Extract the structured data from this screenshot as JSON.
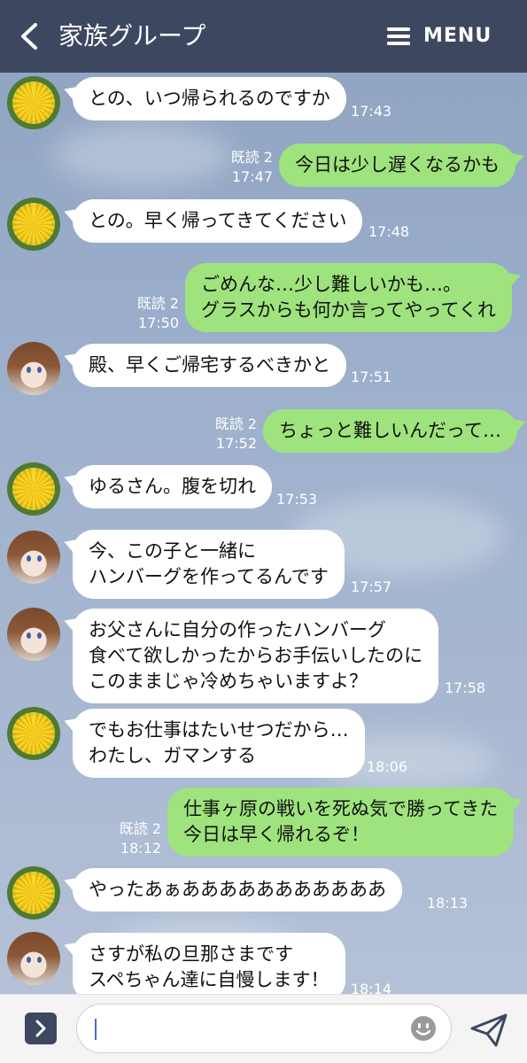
{
  "header": {
    "title": "家族グループ",
    "menu_label": "MENU"
  },
  "messages": [
    {
      "side": "left",
      "avatar": "dandelion",
      "text": "との、いつ帰られるのですか",
      "time": "17:43"
    },
    {
      "side": "right",
      "read": "既読 2",
      "text": "今日は少し遅くなるかも",
      "time": "17:47"
    },
    {
      "side": "left",
      "avatar": "dandelion",
      "text": "との。早く帰ってきてください",
      "time": "17:48"
    },
    {
      "side": "right",
      "read": "既読 2",
      "text": "ごめんな…少し難しいかも…。\nグラスからも何か言ってやってくれ",
      "time": "17:50"
    },
    {
      "side": "left",
      "avatar": "girl",
      "text": "殿、早くご帰宅するべきかと",
      "time": "17:51"
    },
    {
      "side": "right",
      "read": "既読 2",
      "text": "ちょっと難しいんだって…",
      "time": "17:52"
    },
    {
      "side": "left",
      "avatar": "dandelion",
      "text": "ゆるさん。腹を切れ",
      "time": "17:53"
    },
    {
      "side": "left",
      "avatar": "girl",
      "text": "今、この子と一緒に\nハンバーグを作ってるんです",
      "time": "17:57"
    },
    {
      "side": "left",
      "avatar": "girl",
      "text": "お父さんに自分の作ったハンバーグ\n食べて欲しかったからお手伝いしたのに\nこのままじゃ冷めちゃいますよ？",
      "time": "17:58"
    },
    {
      "side": "left",
      "avatar": "dandelion",
      "text": "でもお仕事はたいせつだから…\nわたし、ガマンする",
      "time": "18:06"
    },
    {
      "side": "right",
      "read": "既読 2",
      "text": "仕事ヶ原の戦いを死ぬ気で勝ってきた\n今日は早く帰れるぞ！",
      "time": "18:12"
    },
    {
      "side": "left",
      "avatar": "dandelion",
      "text": "やったあぁあああああああああああ",
      "time": "18:13"
    },
    {
      "side": "left",
      "avatar": "girl",
      "text": "さすが私の旦那さまです\nスペちゃん達に自慢します！",
      "time": "18:14"
    }
  ],
  "composer": {
    "placeholder": ""
  },
  "icons": {
    "back": "chevron-left-icon",
    "menu": "hamburger-icon",
    "expand": "chevron-right-icon",
    "emoji": "smiley-icon",
    "send": "paper-plane-icon"
  },
  "colors": {
    "header": "#3d4760",
    "outgoing_bubble": "#9ee37d",
    "incoming_bubble": "#ffffff"
  }
}
